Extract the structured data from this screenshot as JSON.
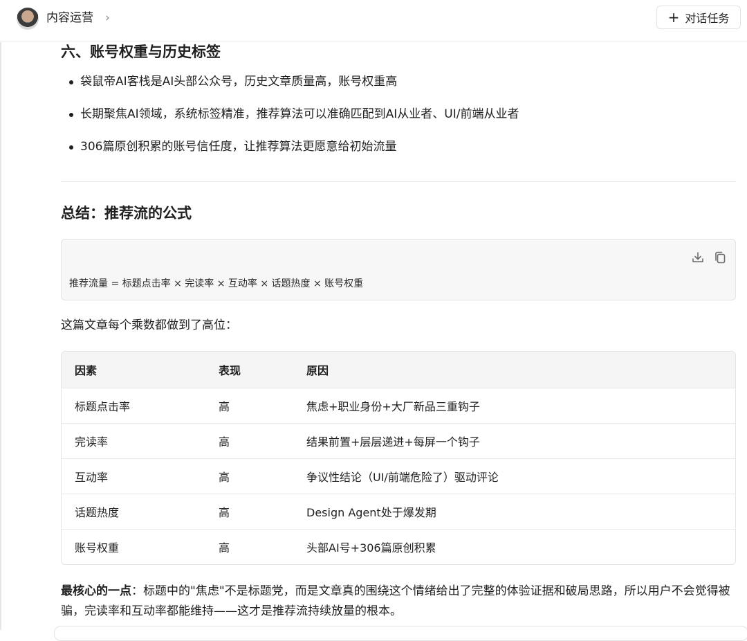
{
  "header": {
    "title": "内容运营",
    "chevron": "›",
    "task_button": {
      "icon": "+",
      "label": "对话任务"
    }
  },
  "section1": {
    "heading": "六、账号权重与历史标签",
    "bullets": [
      "袋鼠帝AI客栈是AI头部公众号，历史文章质量高，账号权重高",
      "长期聚焦AI领域，系统标签精准，推荐算法可以准确匹配到AI从业者、UI/前端从业者",
      "306篇原创积累的账号信任度，让推荐算法更愿意给初始流量"
    ]
  },
  "section2": {
    "heading": "总结：推荐流的公式",
    "code_line": "推荐流量 = 标题点击率 × 完读率 × 互动率 × 话题热度 × 账号权重",
    "intro": "这篇文章每个乘数都做到了高位："
  },
  "table": {
    "headers": [
      "因素",
      "表现",
      "原因"
    ],
    "rows": [
      [
        "标题点击率",
        "高",
        "焦虑+职业身份+大厂新品三重钩子"
      ],
      [
        "完读率",
        "高",
        "结果前置+层层递进+每屏一个钩子"
      ],
      [
        "互动率",
        "高",
        "争议性结论（UI/前端危险了）驱动评论"
      ],
      [
        "话题热度",
        "高",
        "Design Agent处于爆发期"
      ],
      [
        "账号权重",
        "高",
        "头部AI号+306篇原创积累"
      ]
    ]
  },
  "conclusion": {
    "bold": "最核心的一点",
    "text": "：标题中的\"焦虑\"不是标题党，而是文章真的围绕这个情绪给出了完整的体验证据和破局思路，所以用户不会觉得被骗，完读率和互动率都能维持——这才是推荐流持续放量的根本。"
  }
}
